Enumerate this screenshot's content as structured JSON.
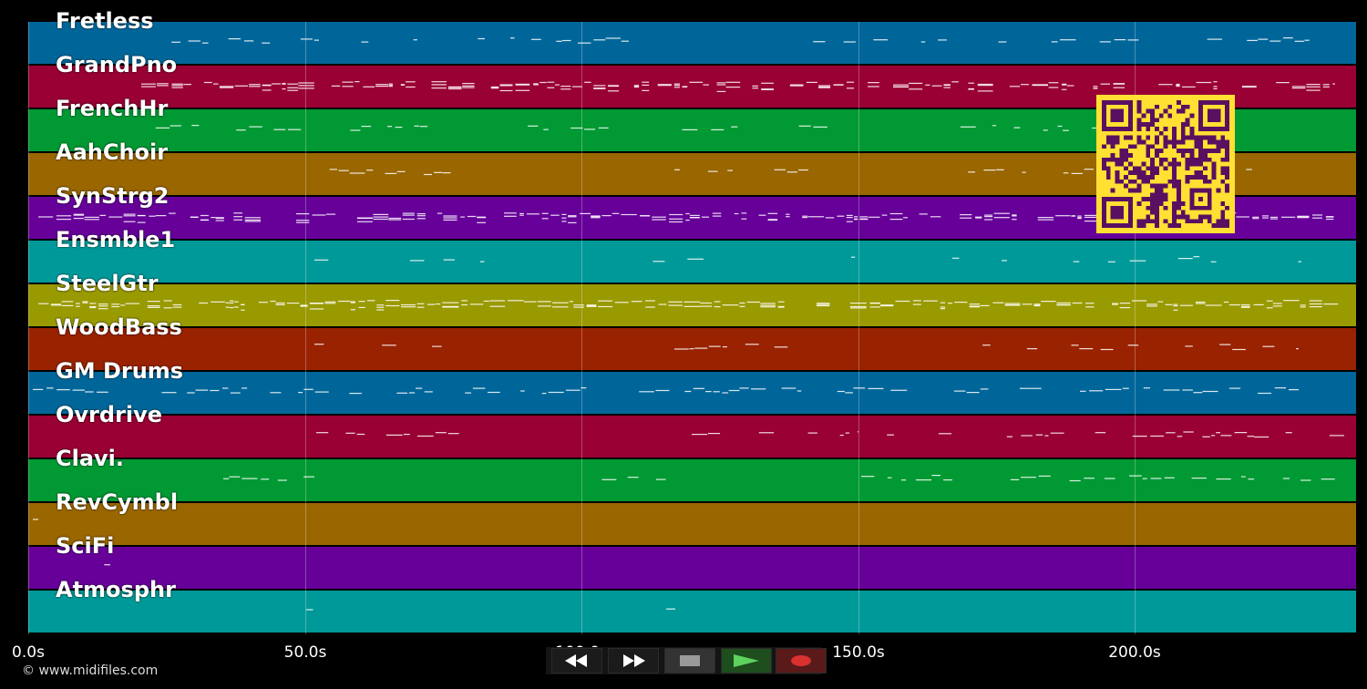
{
  "tracks": [
    {
      "name": "Fretless",
      "color": "#006699"
    },
    {
      "name": "GrandPno",
      "color": "#990033"
    },
    {
      "name": "FrenchHr",
      "color": "#009933"
    },
    {
      "name": "AahChoir",
      "color": "#996600"
    },
    {
      "name": "SynStrg2",
      "color": "#660099"
    },
    {
      "name": "Ensmble1",
      "color": "#009999"
    },
    {
      "name": "SteelGtr",
      "color": "#999900"
    },
    {
      "name": "WoodBass",
      "color": "#992200"
    },
    {
      "name": "GM Drums",
      "color": "#006699"
    },
    {
      "name": "Ovrdrive",
      "color": "#990033"
    },
    {
      "name": "Clavi.",
      "color": "#009933"
    },
    {
      "name": "RevCymbl",
      "color": "#996600"
    },
    {
      "name": "SciFi",
      "color": "#660099"
    },
    {
      "name": "Atmosphr",
      "color": "#009999"
    }
  ],
  "time_axis": {
    "ticks": [
      "0.0s",
      "50.0s",
      "100.0s",
      "150.0s",
      "200.0s"
    ],
    "max_seconds": 240
  },
  "transport": {
    "rewind": "rewind-icon",
    "forward": "fast-forward-icon",
    "stop": "stop-icon",
    "play": "play-icon",
    "record": "record-icon"
  },
  "copyright": "© www.midifiles.com"
}
